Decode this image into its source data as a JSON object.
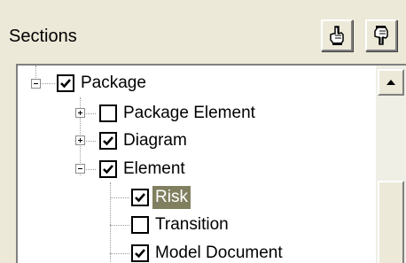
{
  "panel": {
    "title": "Sections"
  },
  "toolbar": {
    "buttons": [
      {
        "icon": "hand-pointer-up-icon"
      },
      {
        "icon": "hand-pointer-down-icon"
      }
    ]
  },
  "tree": {
    "items": [
      {
        "label": "Package",
        "checked": true,
        "expander": "minus",
        "selected": false
      },
      {
        "label": "Package Element",
        "checked": false,
        "expander": "plus",
        "selected": false
      },
      {
        "label": "Diagram",
        "checked": true,
        "expander": "plus",
        "selected": false
      },
      {
        "label": "Element",
        "checked": true,
        "expander": "minus",
        "selected": false
      },
      {
        "label": "Risk",
        "checked": true,
        "expander": null,
        "selected": true
      },
      {
        "label": "Transition",
        "checked": false,
        "expander": null,
        "selected": false
      },
      {
        "label": "Model Document",
        "checked": true,
        "expander": null,
        "selected": false
      }
    ]
  },
  "scrollbar": {
    "up_icon": "scroll-up-arrow-icon"
  }
}
